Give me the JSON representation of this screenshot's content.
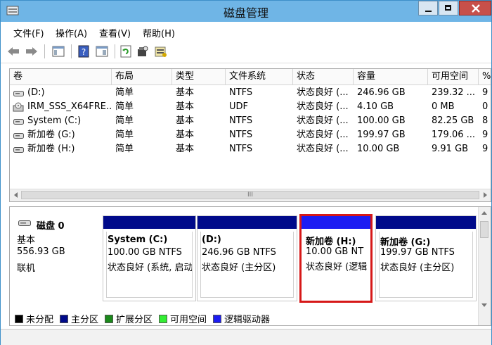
{
  "window": {
    "title": "磁盘管理"
  },
  "menu": [
    "文件(F)",
    "操作(A)",
    "查看(V)",
    "帮助(H)"
  ],
  "columns": [
    "卷",
    "布局",
    "类型",
    "文件系统",
    "状态",
    "容量",
    "可用空间",
    "%"
  ],
  "rows": [
    [
      "(D:)",
      "简单",
      "基本",
      "NTFS",
      "状态良好 (...",
      "246.96 GB",
      "239.32 ...",
      "9"
    ],
    [
      "IRM_SSS_X64FRE...",
      "简单",
      "基本",
      "UDF",
      "状态良好 (...",
      "4.10 GB",
      "0 MB",
      "0"
    ],
    [
      "System (C:)",
      "简单",
      "基本",
      "NTFS",
      "状态良好 (...",
      "100.00 GB",
      "82.25 GB",
      "8"
    ],
    [
      "新加卷 (G:)",
      "简单",
      "基本",
      "NTFS",
      "状态良好 (...",
      "199.97 GB",
      "179.06 ...",
      "9"
    ],
    [
      "新加卷 (H:)",
      "简单",
      "基本",
      "NTFS",
      "状态良好 (...",
      "10.00 GB",
      "9.91 GB",
      "9"
    ]
  ],
  "disk": {
    "name": "磁盘 0",
    "type": "基本",
    "size": "556.93 GB",
    "status": "联机"
  },
  "partitions": [
    {
      "name": "System  (C:)",
      "size": "100.00 GB NTFS",
      "status": "状态良好 (系统, 启动"
    },
    {
      "name": "(D:)",
      "size": "246.96 GB NTFS",
      "status": "状态良好 (主分区)"
    },
    {
      "name": "新加卷  (H:)",
      "size": "10.00 GB NT",
      "status": "状态良好 (逻辑"
    },
    {
      "name": "新加卷  (G:)",
      "size": "199.97 GB NTFS",
      "status": "状态良好 (主分区)"
    }
  ],
  "legend": [
    {
      "label": "未分配",
      "color": "#000000"
    },
    {
      "label": "主分区",
      "color": "#000a8a"
    },
    {
      "label": "扩展分区",
      "color": "#1b8a1b"
    },
    {
      "label": "可用空间",
      "color": "#33ee33"
    },
    {
      "label": "逻辑驱动器",
      "color": "#1c1cf2"
    }
  ],
  "scroll_glyph": "III",
  "colors": {
    "titlebar": "#6fb5e6",
    "primary": "#000a8a",
    "logical": "#1c1cf2",
    "highlight": "#d61818"
  }
}
